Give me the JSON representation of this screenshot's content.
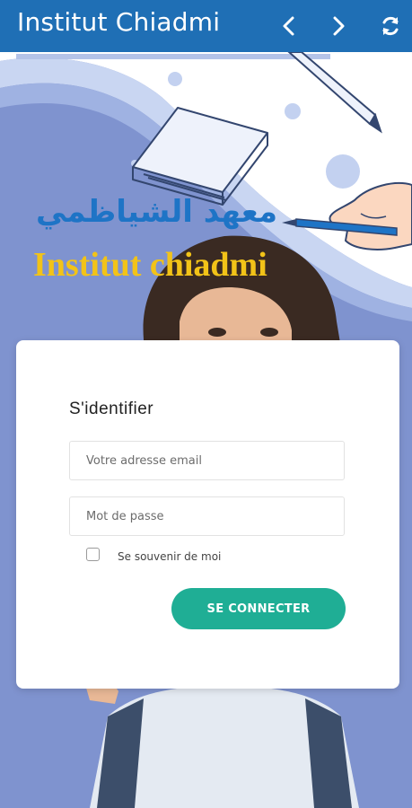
{
  "appbar": {
    "title": "Institut Chiadmi",
    "icons": [
      "chevron-left-icon",
      "chevron-right-icon",
      "refresh-icon"
    ]
  },
  "hero": {
    "brand_arabic": "معهد الشياظمي",
    "brand_latin": "Institut chiadmi",
    "colors": {
      "arabic": "#1e74c6",
      "latin": "#f2c318",
      "background": "#7f93cf"
    }
  },
  "login": {
    "title": "S'identifier",
    "email_placeholder": "Votre adresse email",
    "password_placeholder": "Mot de passe",
    "remember_label": "Se souvenir de moi",
    "submit_label": "SE CONNECTER",
    "submit_color": "#1fae95"
  }
}
